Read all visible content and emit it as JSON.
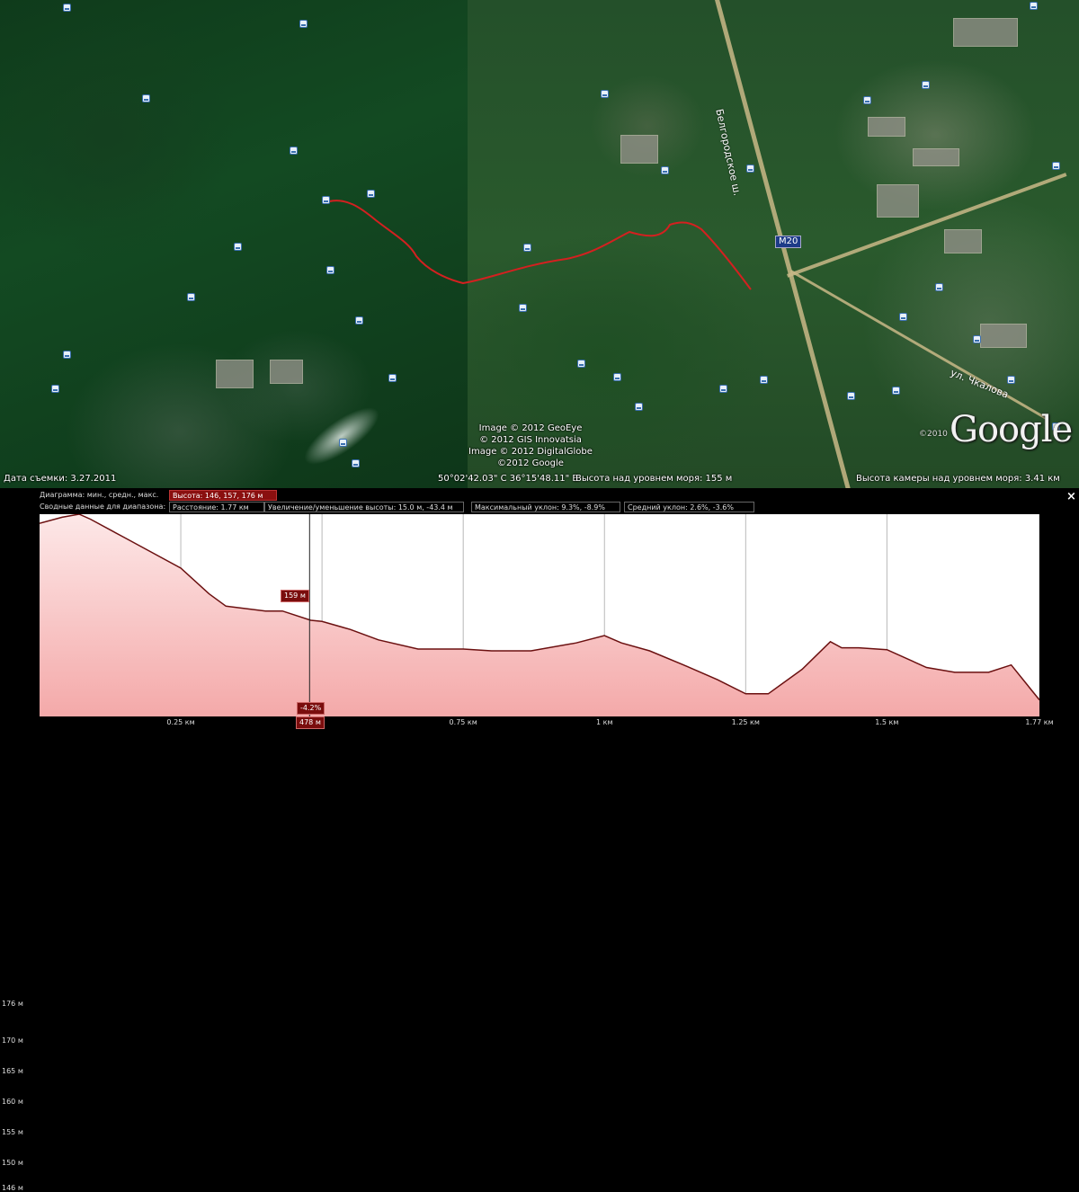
{
  "map": {
    "capture_date": "Дата съемки: 3.27.2011",
    "coordinates": "50°02'42.03\" С  36°15'48.11\" В",
    "ground_elevation": "Высота над уровнем моря:  155 м",
    "camera_elevation": "Высота камеры над уровнем моря:   3.41 км",
    "copyright_lines": [
      "Image © 2012 GeoEye",
      "© 2012 GIS Innovatsia",
      "Image © 2012 DigitalGlobe",
      "©2012 Google"
    ],
    "logo_text": "Google",
    "logo_year": "©2010",
    "road_shield": "M20",
    "road_label_1": "Белгородское ш.",
    "road_label_2": "ул. Чкалова",
    "track_color": "#d42020",
    "pin_icon": "placemark-photo-icon"
  },
  "panel": {
    "row1_label": "Диаграмма: мин., средн., макс.",
    "row1_value": "Высота: 146, 157, 176 м",
    "row2_label": "Сводные данные для диапазона:",
    "distance": "Расстояние: 1.77 км",
    "gain_loss": "Увеличение/уменьшение высоты: 15.0 м, -43.4 м",
    "max_slope": "Максимальный уклон: 9.3%, -8.9%",
    "avg_slope": "Средний уклон: 2.6%, -3.6%",
    "close_label": "×",
    "cursor_elevation": "159 м",
    "cursor_slope": "-4.2%",
    "cursor_distance": "478 м",
    "accent_color": "#8a0f0f",
    "fill_color": "#f7c6c6",
    "line_color": "#6b1010"
  },
  "chart_data": {
    "type": "area",
    "title": "",
    "xlabel": "",
    "ylabel": "",
    "x_unit": "km",
    "y_unit": "m",
    "xlim": [
      0,
      1.77
    ],
    "ylim": [
      143.3,
      176.3
    ],
    "x_ticks": [
      "0.25 км",
      "0.75 км",
      "1 км",
      "1.25 км",
      "1.5 км",
      "1.77 км"
    ],
    "y_ticks": [
      "176 м",
      "170 м",
      "165 м",
      "160 м",
      "155 м",
      "150 м",
      "146 м"
    ],
    "y_tick_values": [
      176,
      170,
      165,
      160,
      155,
      150,
      146
    ],
    "grid": true,
    "cursor_x": 0.478,
    "x": [
      0,
      0.04,
      0.07,
      0.09,
      0.15,
      0.25,
      0.3,
      0.33,
      0.4,
      0.43,
      0.48,
      0.5,
      0.55,
      0.6,
      0.67,
      0.75,
      0.8,
      0.87,
      0.95,
      1.0,
      1.03,
      1.08,
      1.14,
      1.2,
      1.25,
      1.29,
      1.35,
      1.4,
      1.42,
      1.45,
      1.5,
      1.57,
      1.62,
      1.68,
      1.72,
      1.77
    ],
    "y": [
      174.8,
      175.8,
      176.3,
      175.5,
      172.5,
      167.5,
      163.3,
      161.3,
      160.5,
      160.5,
      159.0,
      158.8,
      157.5,
      155.8,
      154.3,
      154.3,
      154.0,
      154.0,
      155.3,
      156.5,
      155.3,
      154.0,
      151.7,
      149.3,
      147.0,
      147.0,
      151.0,
      155.5,
      154.5,
      154.5,
      154.2,
      151.3,
      150.5,
      150.5,
      151.7,
      146.0
    ]
  }
}
